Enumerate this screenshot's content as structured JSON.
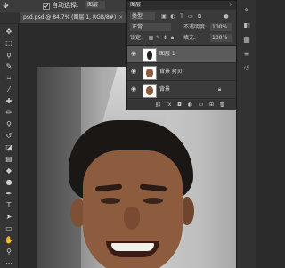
{
  "options_bar": {
    "move_icon": "move-tool-icon",
    "auto_select_label": "自动选择:",
    "auto_select_checked": true,
    "layer_dropdown": "图层"
  },
  "document_tab": {
    "title": "psd.psd @ 84.7% (图层 1, RGB/8#)",
    "close": "×"
  },
  "layers_panel": {
    "title": "图层",
    "close": "×",
    "kind": "类型",
    "blend_mode": "正常",
    "opacity_label": "不透明度:",
    "opacity_value": "100%",
    "lock_label": "锁定:",
    "fill_label": "填充:",
    "fill_value": "100%",
    "layers": [
      {
        "name": "图层 1",
        "selected": true,
        "locked": false
      },
      {
        "name": "背景 拷贝",
        "selected": false,
        "locked": false
      },
      {
        "name": "背景",
        "selected": false,
        "locked": true
      }
    ]
  },
  "colors": {
    "panel_bg": "#3a3a3a",
    "selected_row": "#5b5b5b",
    "app_bg": "#2b2b2b"
  }
}
